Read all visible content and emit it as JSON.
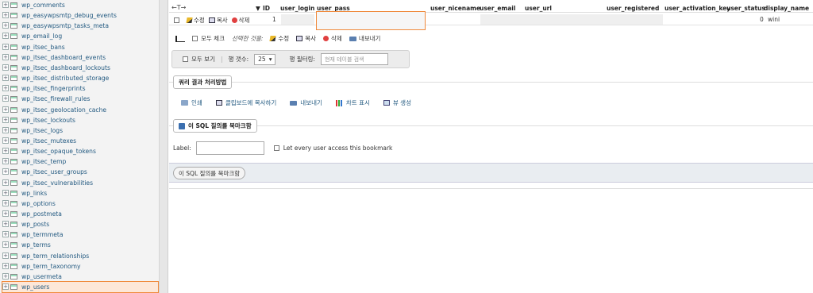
{
  "sidebar": {
    "items": [
      {
        "label": "wp_comments",
        "selected": false
      },
      {
        "label": "wp_easywpsmtp_debug_events",
        "selected": false
      },
      {
        "label": "wp_easywpsmtp_tasks_meta",
        "selected": false
      },
      {
        "label": "wp_email_log",
        "selected": false
      },
      {
        "label": "wp_itsec_bans",
        "selected": false
      },
      {
        "label": "wp_itsec_dashboard_events",
        "selected": false
      },
      {
        "label": "wp_itsec_dashboard_lockouts",
        "selected": false
      },
      {
        "label": "wp_itsec_distributed_storage",
        "selected": false
      },
      {
        "label": "wp_itsec_fingerprints",
        "selected": false
      },
      {
        "label": "wp_itsec_firewall_rules",
        "selected": false
      },
      {
        "label": "wp_itsec_geolocation_cache",
        "selected": false
      },
      {
        "label": "wp_itsec_lockouts",
        "selected": false
      },
      {
        "label": "wp_itsec_logs",
        "selected": false
      },
      {
        "label": "wp_itsec_mutexes",
        "selected": false
      },
      {
        "label": "wp_itsec_opaque_tokens",
        "selected": false
      },
      {
        "label": "wp_itsec_temp",
        "selected": false
      },
      {
        "label": "wp_itsec_user_groups",
        "selected": false
      },
      {
        "label": "wp_itsec_vulnerabilities",
        "selected": false
      },
      {
        "label": "wp_links",
        "selected": false
      },
      {
        "label": "wp_options",
        "selected": false
      },
      {
        "label": "wp_postmeta",
        "selected": false
      },
      {
        "label": "wp_posts",
        "selected": false
      },
      {
        "label": "wp_termmeta",
        "selected": false
      },
      {
        "label": "wp_terms",
        "selected": false
      },
      {
        "label": "wp_term_relationships",
        "selected": false
      },
      {
        "label": "wp_term_taxonomy",
        "selected": false
      },
      {
        "label": "wp_usermeta",
        "selected": false
      },
      {
        "label": "wp_users",
        "selected": true
      }
    ]
  },
  "table": {
    "sort_arrows": "←T→",
    "columns": [
      "ID",
      "user_login",
      "user_pass",
      "user_nicename",
      "user_email",
      "user_url",
      "user_registered",
      "user_activation_key",
      "user_status",
      "display_name"
    ],
    "sort_indicator": "▼",
    "row": {
      "edit": "수정",
      "copy": "복사",
      "delete": "삭제",
      "id": "1",
      "user_status": "0",
      "display_name": "wini"
    }
  },
  "bulk": {
    "check_all": "모두 체크",
    "with_selected": "선택한 것을:",
    "edit": "수정",
    "copy": "복사",
    "delete": "삭제",
    "export": "내보내기"
  },
  "nav": {
    "show_all": "모두 보기",
    "rows_label": "행 갯수:",
    "rows_value": "25",
    "filter_label": "행 필터링:",
    "filter_placeholder": "현재 테이블 검색"
  },
  "query_ops": {
    "legend": "쿼리 결과 처리방법",
    "print": "인쇄",
    "copy_clipboard": "클립보드에 복사하기",
    "export": "내보내기",
    "chart": "차트 표시",
    "create_view": "뷰 생성"
  },
  "bookmark": {
    "legend": "이 SQL 질의를 북마크함",
    "label": "Label:",
    "share": "Let every user access this bookmark",
    "button": "이 SQL 질의를 북마크함"
  },
  "colors": {
    "highlight": "#f08a3c",
    "link": "#235a81"
  }
}
